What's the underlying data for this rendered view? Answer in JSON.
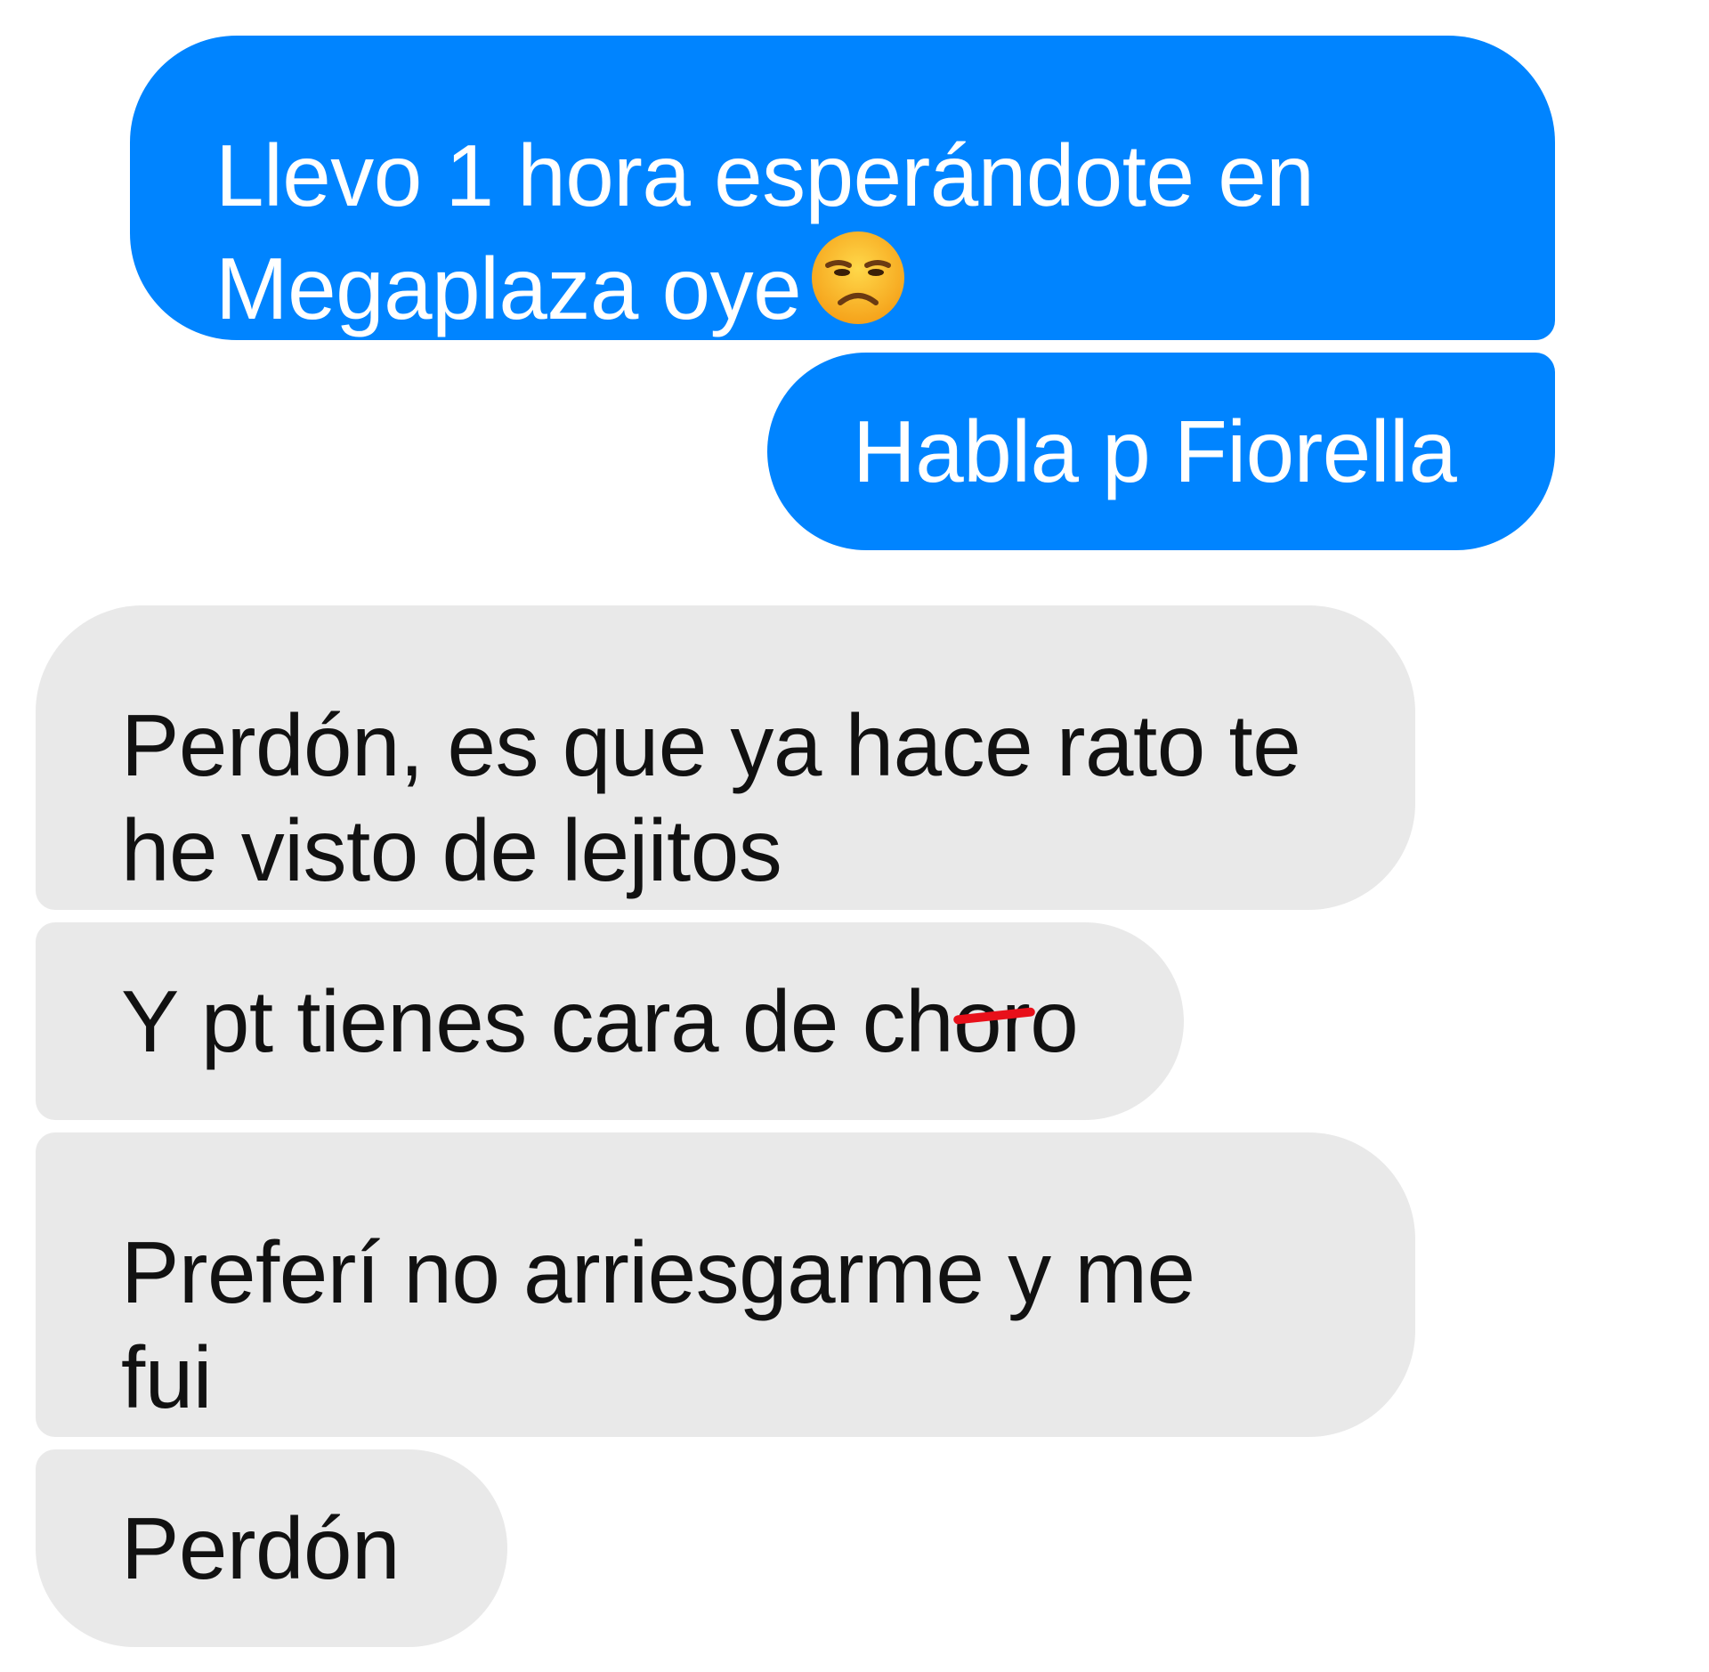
{
  "messages": [
    {
      "direction": "outgoing",
      "lines": [
        "Llevo 1 hora esperándote en",
        "Megaplaza oye"
      ],
      "emoji": "unamused-face-icon"
    },
    {
      "direction": "outgoing",
      "lines": [
        "Habla p Fiorella"
      ]
    },
    {
      "direction": "incoming",
      "lines": [
        "Perdón, es que ya hace rato te",
        "he visto de lejitos"
      ]
    },
    {
      "direction": "incoming",
      "text_before": "Y pt tienes cara de ch",
      "text_struck": "o",
      "text_after": "ro",
      "annotation": "red strike mark over the letter"
    },
    {
      "direction": "incoming",
      "lines": [
        "Preferí no arriesgarme y me",
        "fui"
      ]
    },
    {
      "direction": "incoming",
      "lines": [
        "Perdón"
      ]
    }
  ],
  "colors": {
    "outgoing_bubble": "#0084ff",
    "incoming_bubble": "#e9e9e9",
    "outgoing_text": "#ffffff",
    "incoming_text": "#111111",
    "strike_mark": "#e8101a"
  }
}
